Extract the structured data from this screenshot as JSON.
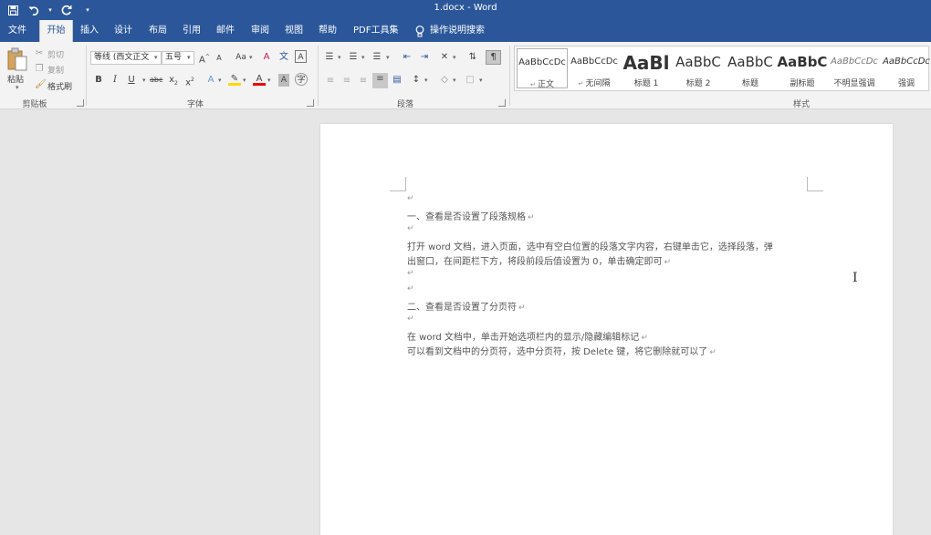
{
  "window": {
    "title": "1.docx  -  Word"
  },
  "quick_access": [
    "save-icon",
    "undo-icon",
    "redo-icon",
    "customize-icon"
  ],
  "tabs": [
    "文件",
    "开始",
    "插入",
    "设计",
    "布局",
    "引用",
    "邮件",
    "审阅",
    "视图",
    "帮助",
    "PDF工具集"
  ],
  "tell_me": "操作说明搜索",
  "ribbon": {
    "clipboard": {
      "paste": "粘贴",
      "cut": "剪切",
      "copy": "复制",
      "format_painter": "格式刷",
      "group": "剪贴板"
    },
    "font": {
      "font_name": "等线 (西文正文",
      "font_size": "五号",
      "group": "字体"
    },
    "paragraph": {
      "group": "段落"
    },
    "styles": {
      "group": "样式",
      "items": [
        {
          "preview": "AaBbCcDc",
          "name": "正文"
        },
        {
          "preview": "AaBbCcDc",
          "name": "无间隔"
        },
        {
          "preview": "AaBl",
          "name": "标题 1"
        },
        {
          "preview": "AaBbC",
          "name": "标题 2"
        },
        {
          "preview": "AaBbC",
          "name": "标题"
        },
        {
          "preview": "AaBbC",
          "name": "副标题"
        },
        {
          "preview": "AaBbCcDc",
          "name": "不明显强调"
        },
        {
          "preview": "AaBbCcDc",
          "name": "强调"
        }
      ]
    }
  },
  "document": {
    "para_mark": "↵",
    "lines": [
      "一、查看是否设置了段落规格",
      "打开 word 文档，进入页面，选中有空白位置的段落文字内容，右键单击它，选择段落，弹",
      "出窗口，在间距栏下方，将段前段后值设置为 0，单击确定即可",
      "二、查看是否设置了分页符",
      "在 word 文档中，单击开始选项栏内的显示/隐藏编辑标记",
      "可以看到文档中的分页符，选中分页符，按 Delete 键，将它删除就可以了"
    ]
  }
}
